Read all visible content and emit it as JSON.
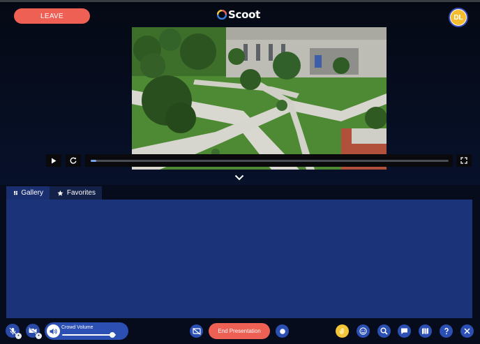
{
  "header": {
    "leave_label": "LEAVE",
    "logo_text": "Scoot",
    "avatar_initials": "DL"
  },
  "video": {
    "progress": 0.015
  },
  "tabs": [
    {
      "label": "Gallery",
      "icon": "grid-icon",
      "active": true
    },
    {
      "label": "Favorites",
      "icon": "star-icon",
      "active": false
    }
  ],
  "bottom_bar": {
    "crowd_volume_label": "Crowd Volume",
    "crowd_volume_level": 0.93,
    "end_presentation_label": "End Presentation"
  },
  "colors": {
    "accent_red": "#ee5f54",
    "panel_blue": "#1b3479",
    "control_blue": "#2b4fb3",
    "reaction_yellow": "#f3c63a"
  }
}
